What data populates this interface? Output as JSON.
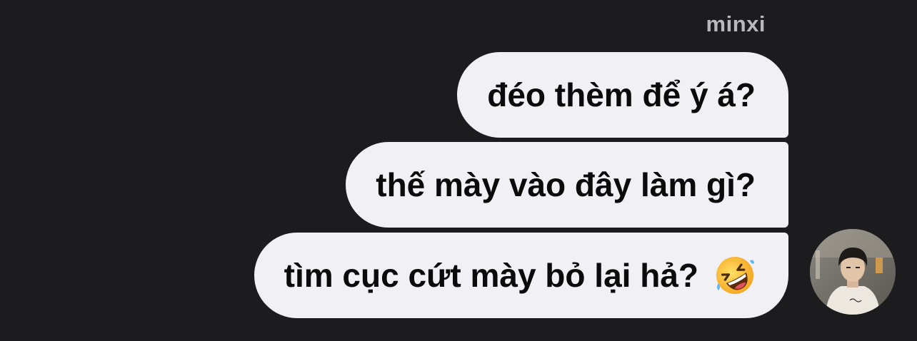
{
  "conversation": {
    "sender_name": "minxi",
    "messages": [
      {
        "text": "đéo thèm để ý á?"
      },
      {
        "text": "thế mày vào đây làm gì?"
      },
      {
        "text": "tìm cục cứt mày bỏ lại hả?",
        "emoji": "rolling-on-floor-laughing-emoji"
      }
    ]
  },
  "avatar": {
    "icon": "user-avatar-photo"
  },
  "colors": {
    "background": "#1c1c1e",
    "bubble": "#f1f1f5",
    "bubble_text": "#0b0b0c",
    "sender_name": "#b9b9bd"
  }
}
